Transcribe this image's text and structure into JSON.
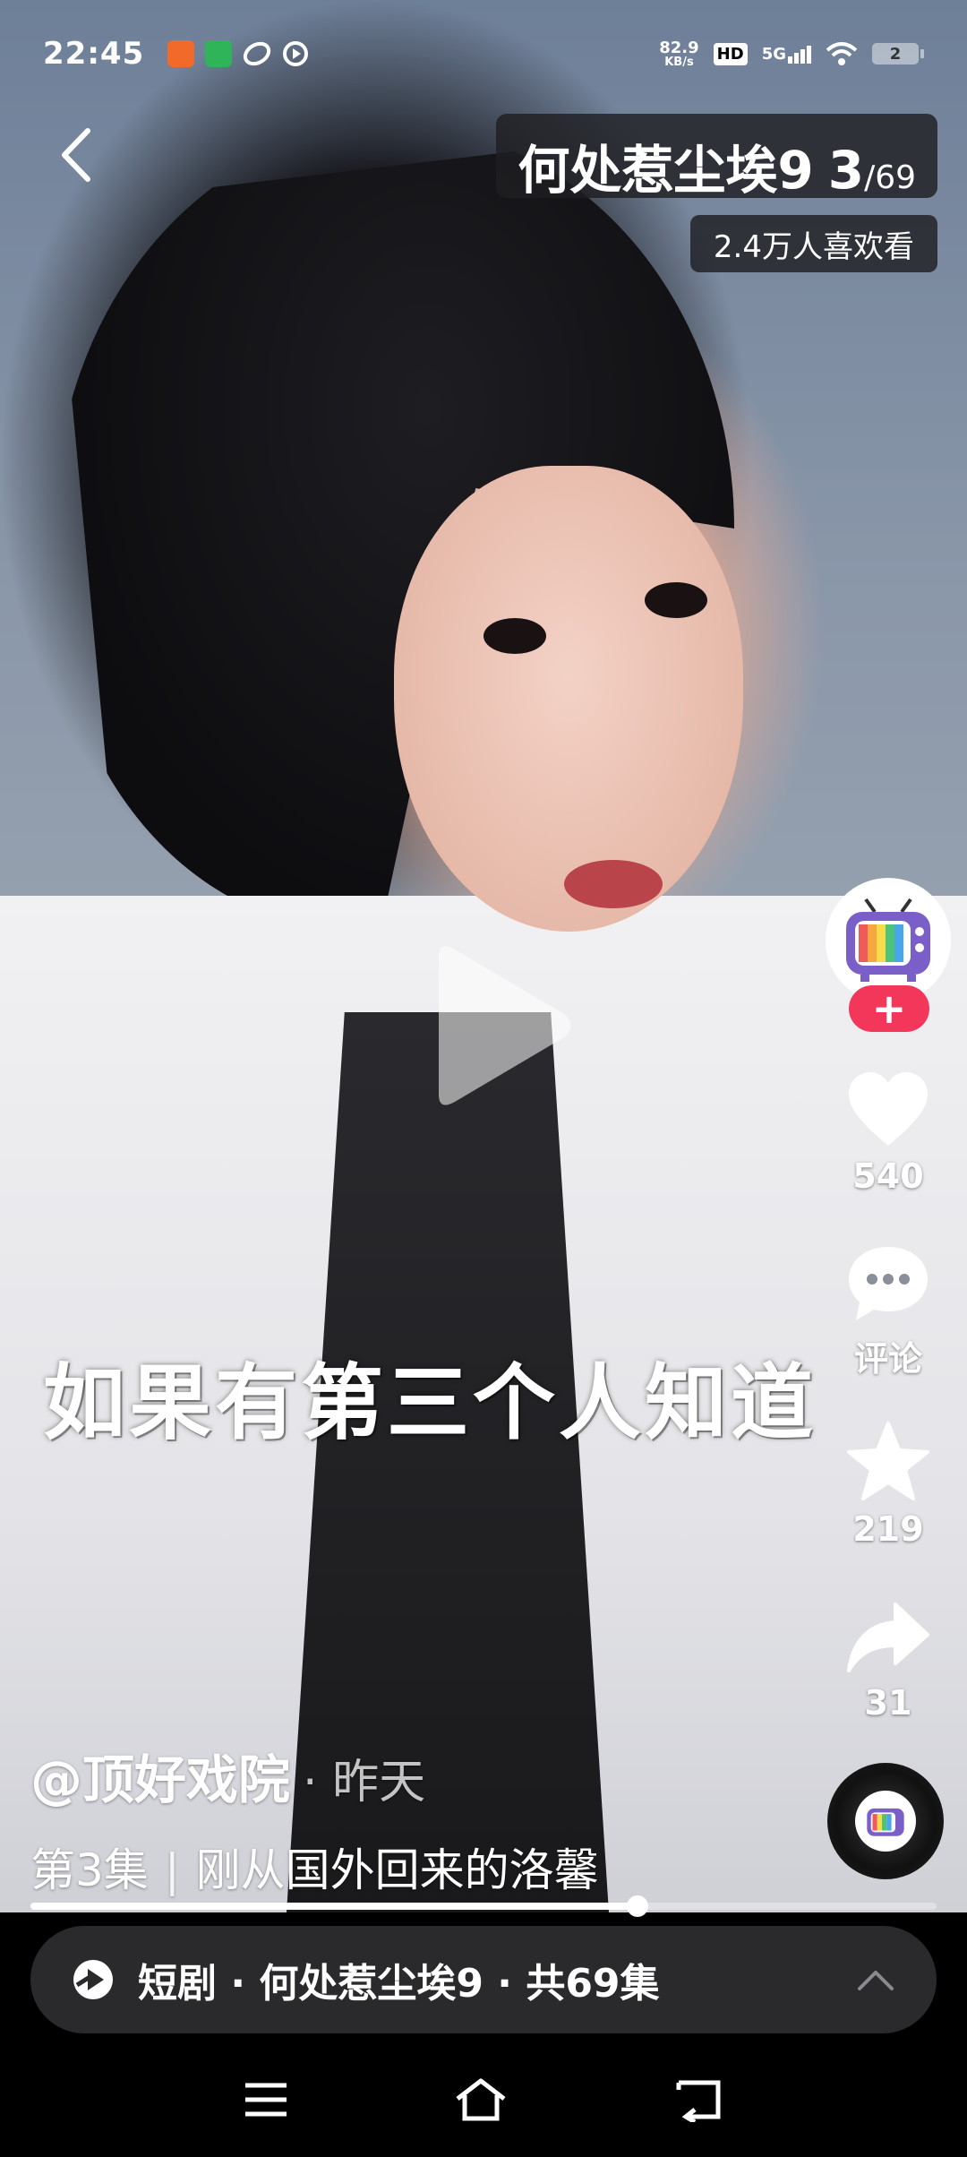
{
  "status_bar": {
    "time": "22:45",
    "net_speed": "82.9",
    "net_unit": "KB/s",
    "hd": "HD",
    "signal": "5G",
    "battery": "2",
    "app_icons": [
      "app-icon-orange",
      "app-icon-green",
      "app-icon-swirl",
      "app-icon-play"
    ]
  },
  "header": {
    "title": "何处惹尘埃9",
    "episode_current": "3",
    "episode_total": "/69",
    "likes_badge": "2.4万人喜欢看"
  },
  "video": {
    "subtitle": "如果有第三个人知道"
  },
  "rail": {
    "follow_label": "+",
    "like_count": "540",
    "comment_label": "评论",
    "favorite_count": "219",
    "share_count": "31"
  },
  "info": {
    "author": "@顶好戏院",
    "time": "· 昨天",
    "episode_label": "第3集",
    "separator": "|",
    "description": "刚从国外回来的洛馨"
  },
  "progress": {
    "fraction": 0.67
  },
  "series_bar": {
    "text": "短剧 · 何处惹尘埃9 · 共69集"
  },
  "colors": {
    "follow_pink": "#f2375a",
    "series_bg": "#2a2a2d"
  }
}
